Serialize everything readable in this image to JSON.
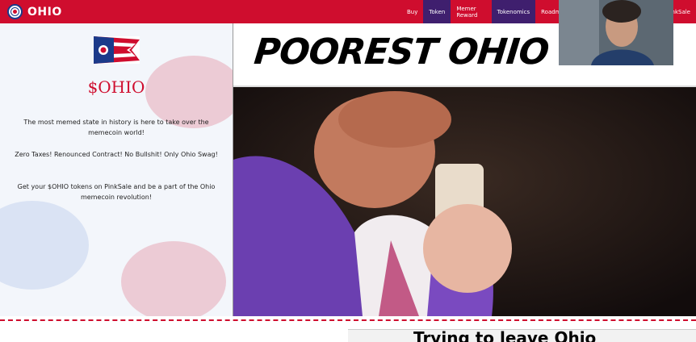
{
  "brand": {
    "name": "OHIO"
  },
  "nav": [
    {
      "label": "Buy",
      "active": false
    },
    {
      "label": "Token",
      "active": true
    },
    {
      "label": "Memer Reward",
      "active": false
    },
    {
      "label": "Tokenomics",
      "active": true
    },
    {
      "label": "Roadm",
      "active": false
    },
    {
      "label": "nkSale",
      "active": false
    }
  ],
  "left": {
    "title": "$OHIO",
    "p1": "The most memed state in history is here to take over the memecoin world!",
    "p2": "Zero Taxes! Renounced Contract! No Bullshit! Only Ohio Swag!",
    "p3": "Get your $OHIO tokens on PinkSale and be a part of the Ohio memecoin revolution!"
  },
  "hero": {
    "caption": "POOREST OHIO CIT"
  },
  "section2": {
    "caption": "Trying to leave Ohio"
  },
  "colors": {
    "brand_red": "#cf0d2e",
    "nav_active": "#3f1f6e",
    "navy": "#1b3a8a"
  }
}
